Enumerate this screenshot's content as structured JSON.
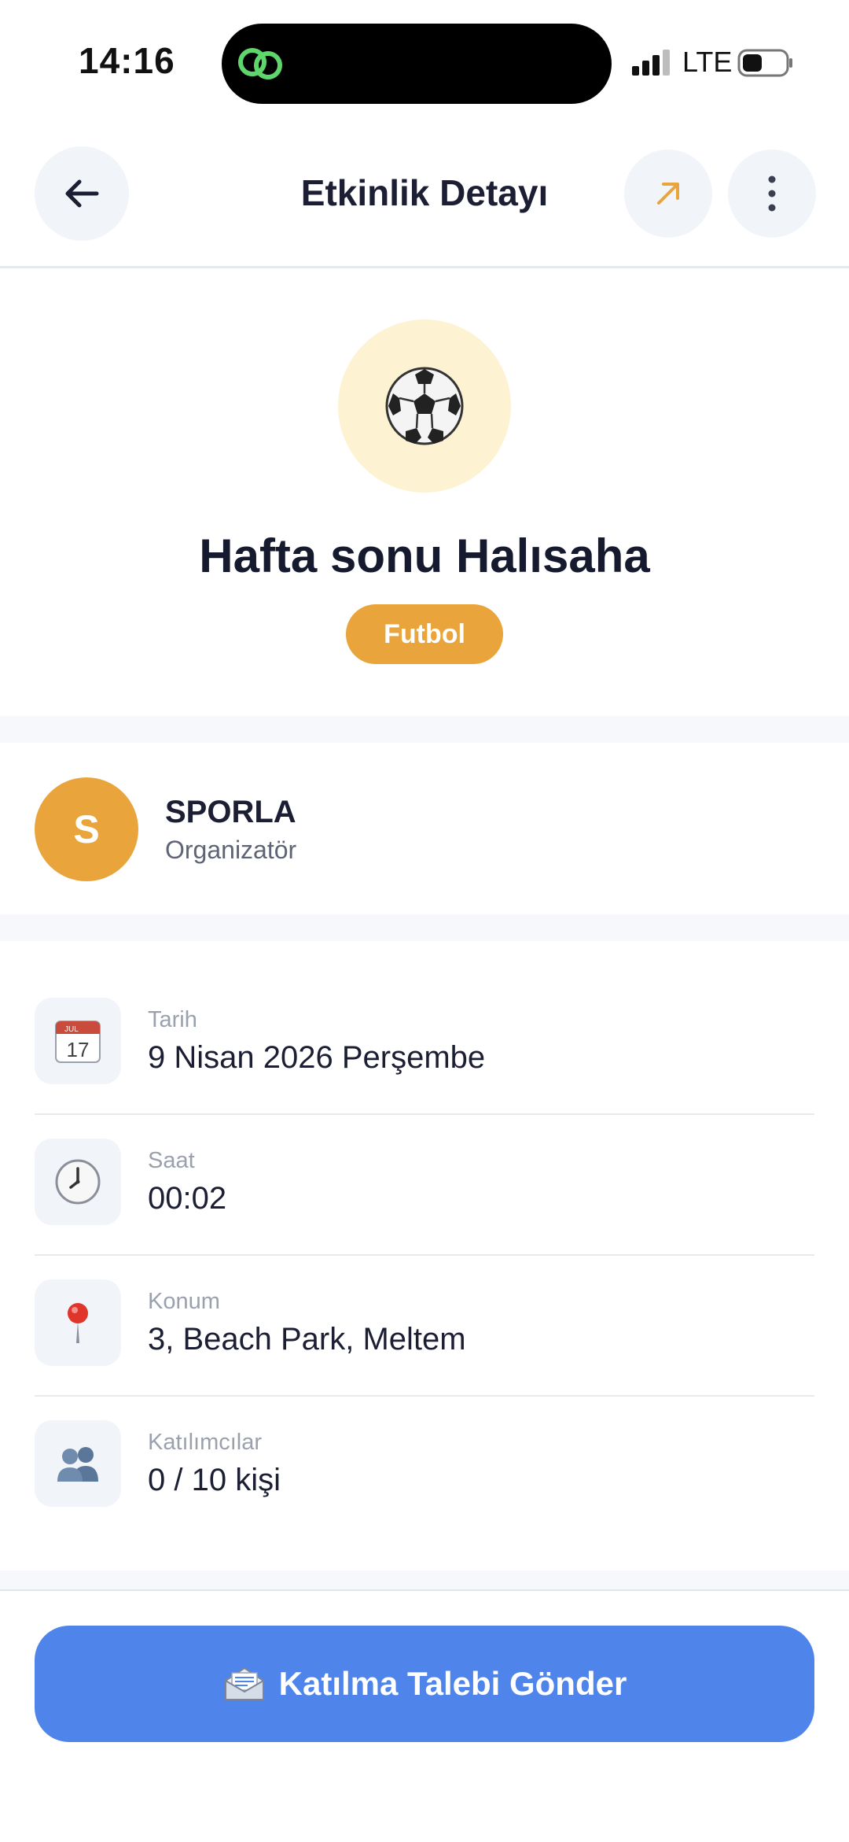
{
  "status_bar": {
    "time": "14:16",
    "network": "LTE",
    "icons": [
      "signal-icon",
      "battery-icon",
      "link-icon"
    ]
  },
  "header": {
    "title": "Etkinlik Detayı",
    "back_icon": "arrow-left-icon",
    "share_icon": "arrow-up-right-icon",
    "more_icon": "more-vertical-icon",
    "accent_color": "#e9a43b"
  },
  "event": {
    "emoji": "⚽",
    "title": "Hafta sonu Halısaha",
    "category": "Futbol",
    "category_color": "#e9a43b"
  },
  "organizer": {
    "initial": "S",
    "name": "SPORLA",
    "role": "Organizatör",
    "avatar_color": "#e9a43b"
  },
  "details": [
    {
      "icon": "calendar-icon",
      "label": "Tarih",
      "value": "9 Nisan 2026 Perşembe"
    },
    {
      "icon": "clock-icon",
      "label": "Saat",
      "value": "00:02"
    },
    {
      "icon": "pin-icon",
      "label": "Konum",
      "value": "3, Beach Park, Meltem"
    },
    {
      "icon": "people-icon",
      "label": "Katılımcılar",
      "value": "0 / 10 kişi"
    }
  ],
  "calendar_icon_text": {
    "month": "JUL",
    "day": "17"
  },
  "join_button": {
    "icon": "envelope-icon",
    "label": "Katılma Talebi Gönder",
    "color": "#4f84ea"
  }
}
